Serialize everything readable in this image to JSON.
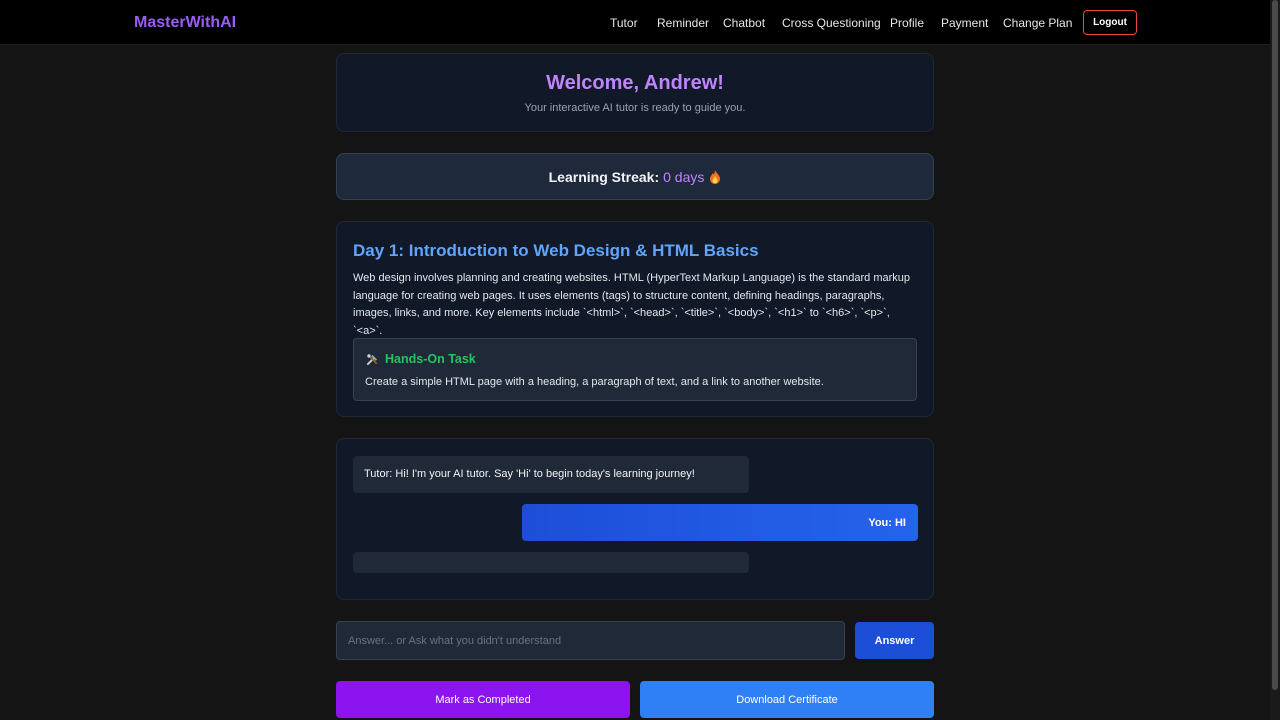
{
  "nav": {
    "brand": "MasterWithAI",
    "links": [
      "Tutor",
      "Reminder",
      "Chatbot",
      "Cross Questioning",
      "Profile",
      "Payment",
      "Change Plan"
    ],
    "logout_label": "Logout"
  },
  "welcome": {
    "title": "Welcome, Andrew!",
    "subtitle": "Your interactive AI tutor is ready to guide you."
  },
  "streak": {
    "label": "Learning Streak:",
    "value": "0 days",
    "icon": "flame-icon"
  },
  "lesson": {
    "title": "Day 1: Introduction to Web Design & HTML Basics",
    "body": "Web design involves planning and creating websites. HTML (HyperText Markup Language) is the standard markup language for creating web pages. It uses elements (tags) to structure content, defining headings, paragraphs, images, links, and more. Key elements include `<html>`, `<head>`, `<title>`, `<body>`, `<h1>` to `<h6>`, `<p>`, `<a>`.",
    "task": {
      "icon": "tools-icon",
      "title": "Hands-On Task",
      "text": "Create a simple HTML page with a heading, a paragraph of text, and a link to another website."
    }
  },
  "chat": {
    "messages": [
      {
        "role": "tutor",
        "text": "Tutor: Hi! I'm your AI tutor. Say 'Hi' to begin today's learning journey!"
      },
      {
        "role": "user",
        "text": "You: HI"
      }
    ]
  },
  "answer": {
    "placeholder": "Answer... or Ask what you didn't understand",
    "value": "",
    "button_label": "Answer"
  },
  "actions": {
    "complete_label": "Mark as Completed",
    "certificate_label": "Download Certificate"
  },
  "colors": {
    "brand": "#9b5cf6",
    "welcome_title": "#c084fc",
    "lesson_title": "#60a5fa",
    "task_title": "#22c55e",
    "logout_border": "#ef4444",
    "user_bubble": "#1d4ed8",
    "complete_button": "#8b14f0",
    "certificate_button": "#2f7ff5"
  }
}
